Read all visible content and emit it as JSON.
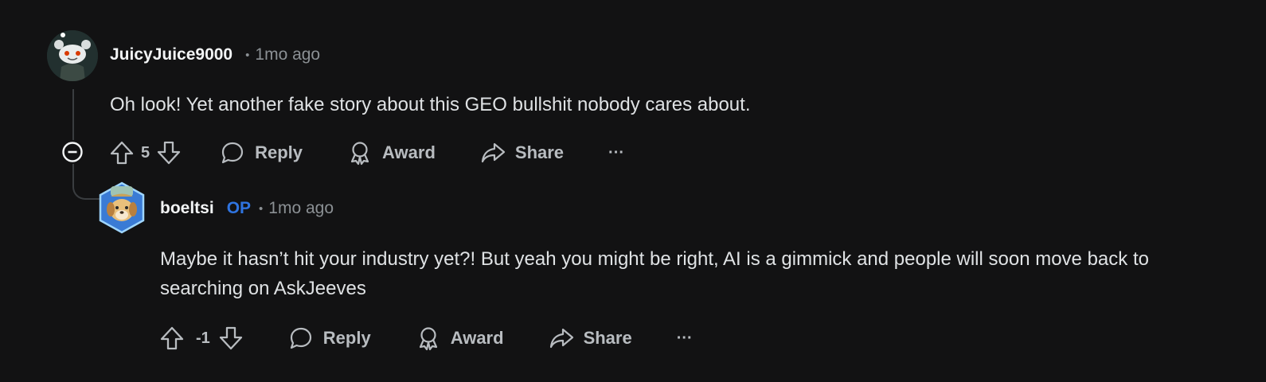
{
  "comments": [
    {
      "username": "JuicyJuice9000",
      "separator": "•",
      "timestamp": "1mo ago",
      "body": "Oh look! Yet another fake story about this GEO bullshit nobody cares about.",
      "score": "5",
      "actions": {
        "reply": "Reply",
        "award": "Award",
        "share": "Share",
        "more": "···"
      }
    },
    {
      "username": "boeltsi",
      "op_badge": "OP",
      "separator": "•",
      "timestamp": "1mo ago",
      "body": "Maybe it hasn’t hit your industry yet?! But yeah you might be right, AI is a gimmick and people will soon move back to searching on AskJeeves",
      "score": "-1",
      "actions": {
        "reply": "Reply",
        "award": "Award",
        "share": "Share",
        "more": "···"
      }
    }
  ],
  "colors": {
    "background": "#121213",
    "op_badge": "#2f74e0",
    "text": "#dfe2e4",
    "muted": "#8b9094"
  }
}
